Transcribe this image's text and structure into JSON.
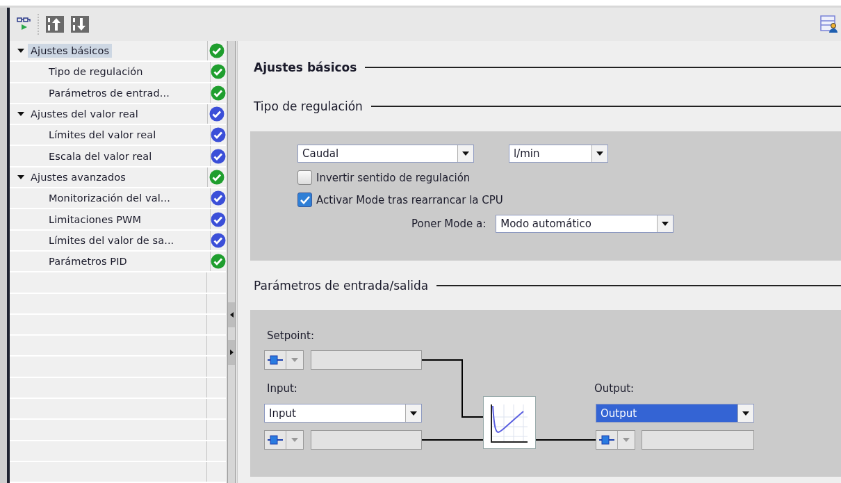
{
  "tree": [
    {
      "label": "Ajustes básicos",
      "selected": true,
      "expanded": true,
      "color": "#1f9e2e",
      "children": [
        {
          "label": "Tipo de regulación",
          "selected": false,
          "color": "#1f9e2e"
        },
        {
          "label": "Parámetros de entrad...",
          "selected": false,
          "color": "#1f9e2e"
        }
      ]
    },
    {
      "label": "Ajustes del valor real",
      "selected": false,
      "expanded": true,
      "color": "#3b4fd8",
      "children": [
        {
          "label": "Límites del valor real",
          "selected": false,
          "color": "#3b4fd8"
        },
        {
          "label": "Escala del valor real",
          "selected": false,
          "color": "#3b4fd8"
        }
      ]
    },
    {
      "label": "Ajustes avanzados",
      "selected": false,
      "expanded": true,
      "color": "#1f9e2e",
      "children": [
        {
          "label": "Monitorización del val...",
          "selected": false,
          "color": "#3b4fd8"
        },
        {
          "label": "Limitaciones PWM",
          "selected": false,
          "color": "#3b4fd8"
        },
        {
          "label": "Límites del valor de sa...",
          "selected": false,
          "color": "#3b4fd8"
        },
        {
          "label": "Parámetros PID",
          "selected": false,
          "color": "#1f9e2e"
        }
      ]
    }
  ],
  "basic_settings": {
    "title": "Ajustes básicos"
  },
  "control_type": {
    "title": "Tipo de regulación",
    "type_select": {
      "value": "Caudal"
    },
    "unit_select": {
      "value": "l/min"
    },
    "checkboxes": [
      {
        "label": "Invertir sentido de regulación",
        "checked": false
      },
      {
        "label": "Activar Mode tras rearrancar la CPU",
        "checked": true
      }
    ],
    "mode": {
      "label": "Poner Mode a:",
      "value": "Modo automático"
    }
  },
  "io_params": {
    "title": "Parámetros de entrada/salida",
    "setpoint": {
      "label": "Setpoint:"
    },
    "input": {
      "label": "Input:",
      "value": "Input",
      "selected": false
    },
    "output": {
      "label": "Output:",
      "value": "Output",
      "selected": true
    }
  }
}
